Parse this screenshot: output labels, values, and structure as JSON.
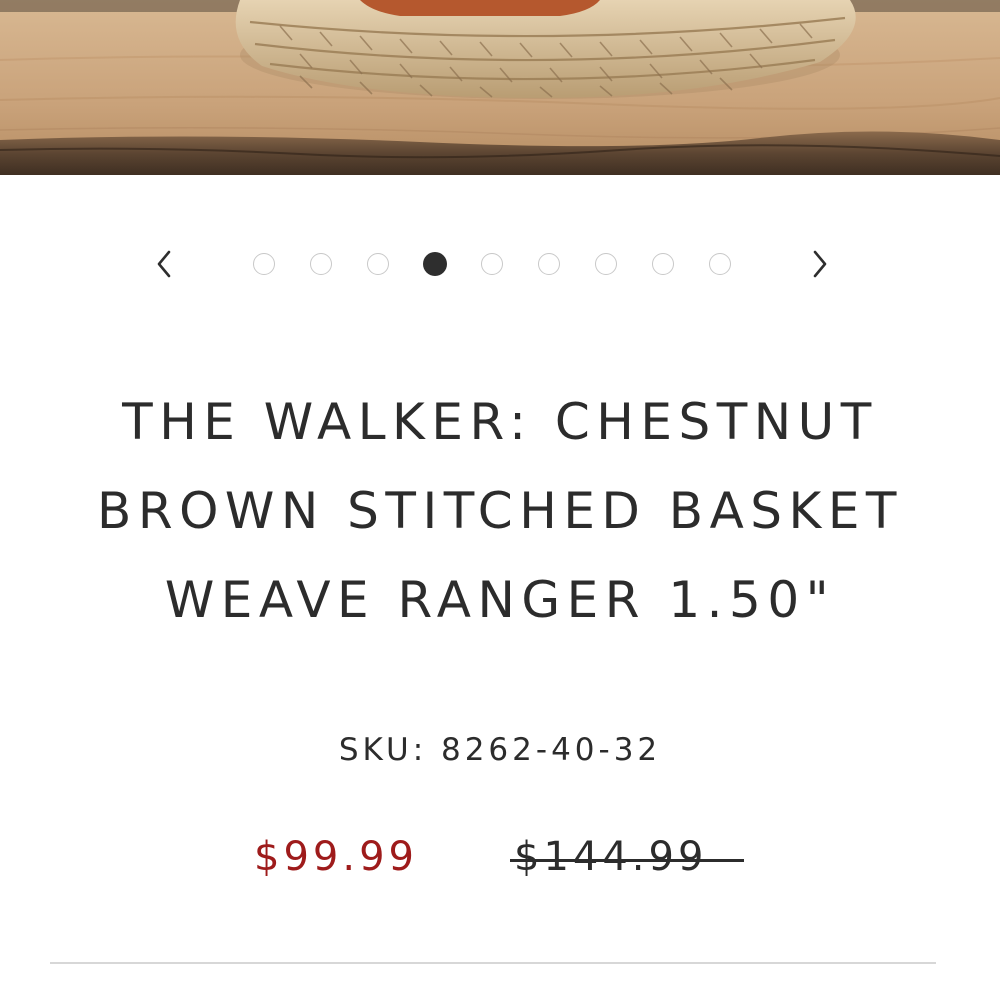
{
  "product": {
    "title": "THE WALKER: CHESTNUT BROWN STITCHED BASKET WEAVE RANGER 1.50\"",
    "sku": "SKU: 8262-40-32",
    "price_sale": "$99.99",
    "price_original": "$144.99"
  },
  "gallery": {
    "image_count": 9,
    "active_index": 4,
    "prev_icon": "chevron-left-icon",
    "next_icon": "chevron-right-icon"
  },
  "colors": {
    "sale_price": "#9e1b1b",
    "text": "#2c2c2c",
    "dot_inactive_border": "#c9c9c9",
    "dot_active": "#2e2e2e"
  }
}
